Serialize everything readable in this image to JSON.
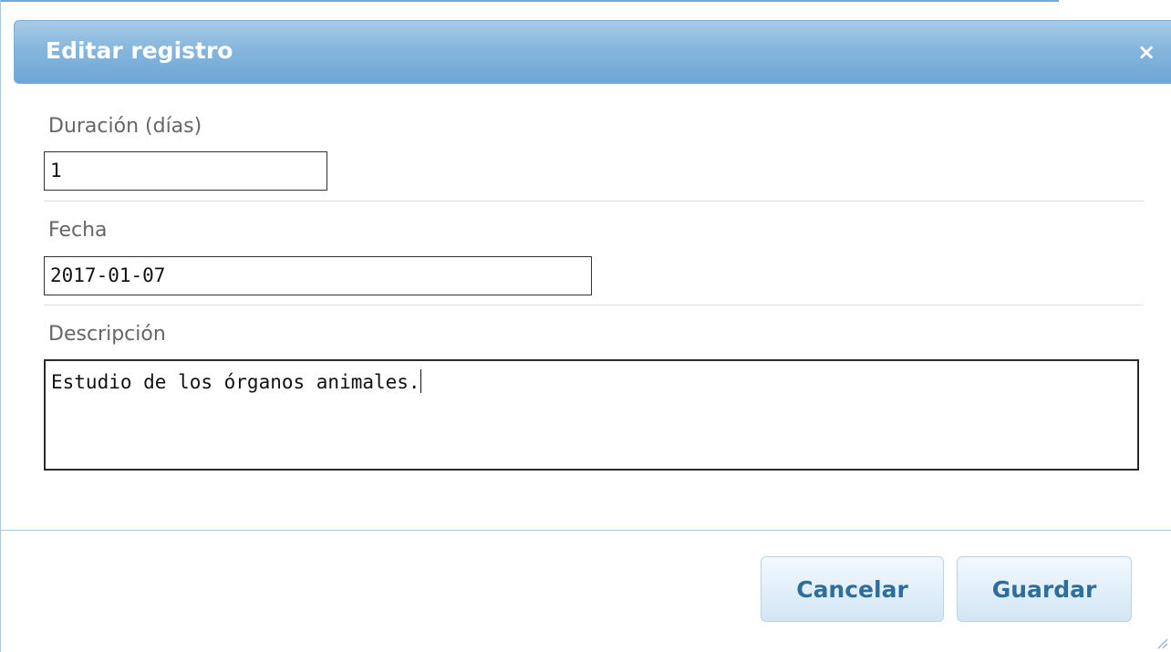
{
  "dialog": {
    "title": "Editar registro",
    "close_symbol": "×"
  },
  "form": {
    "duration": {
      "label": "Duración (días)",
      "value": "1"
    },
    "date": {
      "label": "Fecha",
      "value": "2017-01-07"
    },
    "description": {
      "label": "Descripción",
      "value": "Estudio de los órganos animales."
    }
  },
  "buttons": {
    "cancel": "Cancelar",
    "save": "Guardar"
  },
  "icons": {
    "close": "close-icon",
    "resize": "resize-grip-icon"
  },
  "colors": {
    "titlebar": "#86b6dd",
    "button_text": "#2e6e9e",
    "label_text": "#666666"
  }
}
